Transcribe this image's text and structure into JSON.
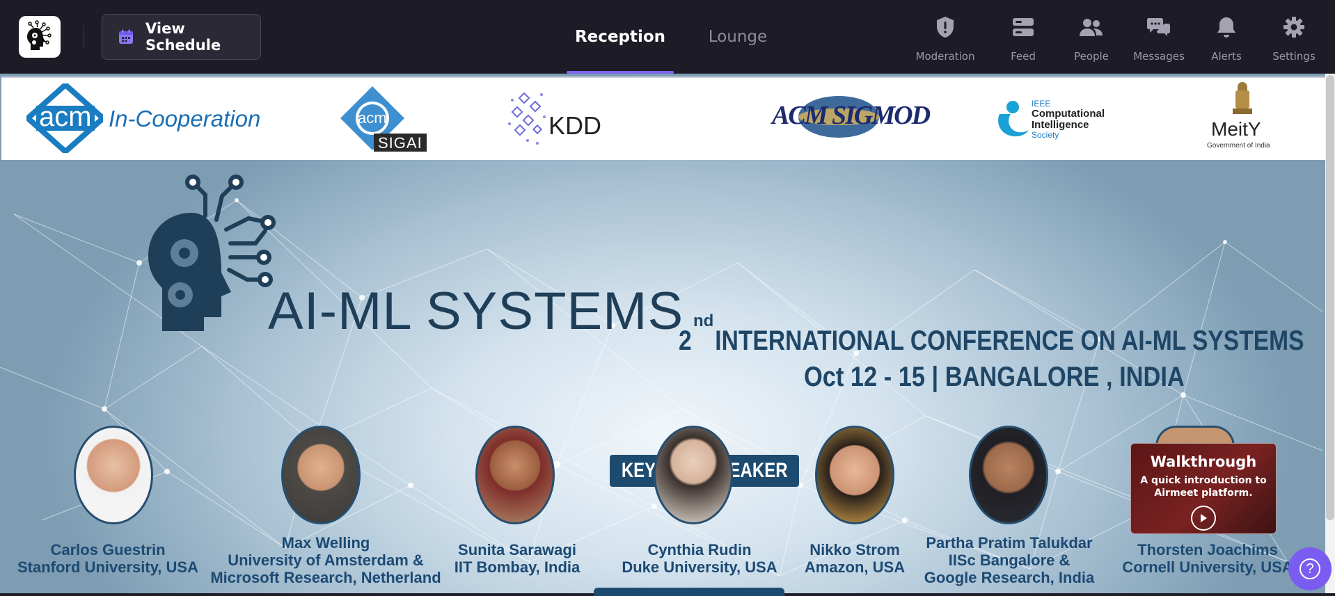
{
  "toolbar": {
    "view_schedule_label": "View Schedule"
  },
  "tabs": [
    {
      "label": "Reception",
      "active": true
    },
    {
      "label": "Lounge",
      "active": false
    }
  ],
  "nav": [
    {
      "label": "Moderation",
      "icon": "shield-icon"
    },
    {
      "label": "Feed",
      "icon": "feed-icon"
    },
    {
      "label": "People",
      "icon": "people-icon"
    },
    {
      "label": "Messages",
      "icon": "messages-icon"
    },
    {
      "label": "Alerts",
      "icon": "bell-icon"
    },
    {
      "label": "Settings",
      "icon": "gear-icon"
    }
  ],
  "sponsors": {
    "acm_main": "acm",
    "acm_coop": "In-Cooperation",
    "sigai_acm": "acm",
    "sigai": "SIGAI",
    "kdd": "KDD",
    "sigmod": "ACM SIGMOD",
    "ieee_small": "IEEE",
    "ieee_lines": [
      "Computational",
      "Intelligence",
      "Society"
    ],
    "meity": "MeitY",
    "meity_sub": "Government of India"
  },
  "banner": {
    "title": "AI-ML SYSTEMS",
    "ordinal_number": "2",
    "ordinal_suffix": "nd",
    "conference_line": "INTERNATIONAL CONFERENCE ON AI-ML SYSTEMS",
    "date_location": "Oct 12 - 15 | BANGALORE , INDIA",
    "keynote_label": "KEYNOTE SPEAKER"
  },
  "speakers": [
    {
      "name": "Carlos Guestrin",
      "affiliation": [
        "Stanford University, USA"
      ]
    },
    {
      "name": "Max Welling",
      "affiliation": [
        "University of Amsterdam &",
        "Microsoft Research, Netherland"
      ]
    },
    {
      "name": "Sunita Sarawagi",
      "affiliation": [
        "IIT Bombay, India"
      ]
    },
    {
      "name": "Cynthia Rudin",
      "affiliation": [
        "Duke University, USA"
      ]
    },
    {
      "name": "Nikko Strom",
      "affiliation": [
        "Amazon, USA"
      ]
    },
    {
      "name": "Partha Pratim Talukdar",
      "affiliation": [
        "IISc Bangalore &",
        "Google Research, India"
      ]
    },
    {
      "name": "Thorsten Joachims",
      "affiliation": [
        "Cornell University, USA"
      ]
    }
  ],
  "walkthrough": {
    "title": "Walkthrough",
    "description_lines": [
      "A quick introduction to",
      "Airmeet platform."
    ]
  },
  "help": {
    "icon": "help-icon",
    "glyph": "?"
  },
  "colors": {
    "topbar": "#1d1c26",
    "accent": "#7b68ee",
    "banner_text": "#1f4666",
    "help_button": "#7b5cf0"
  }
}
